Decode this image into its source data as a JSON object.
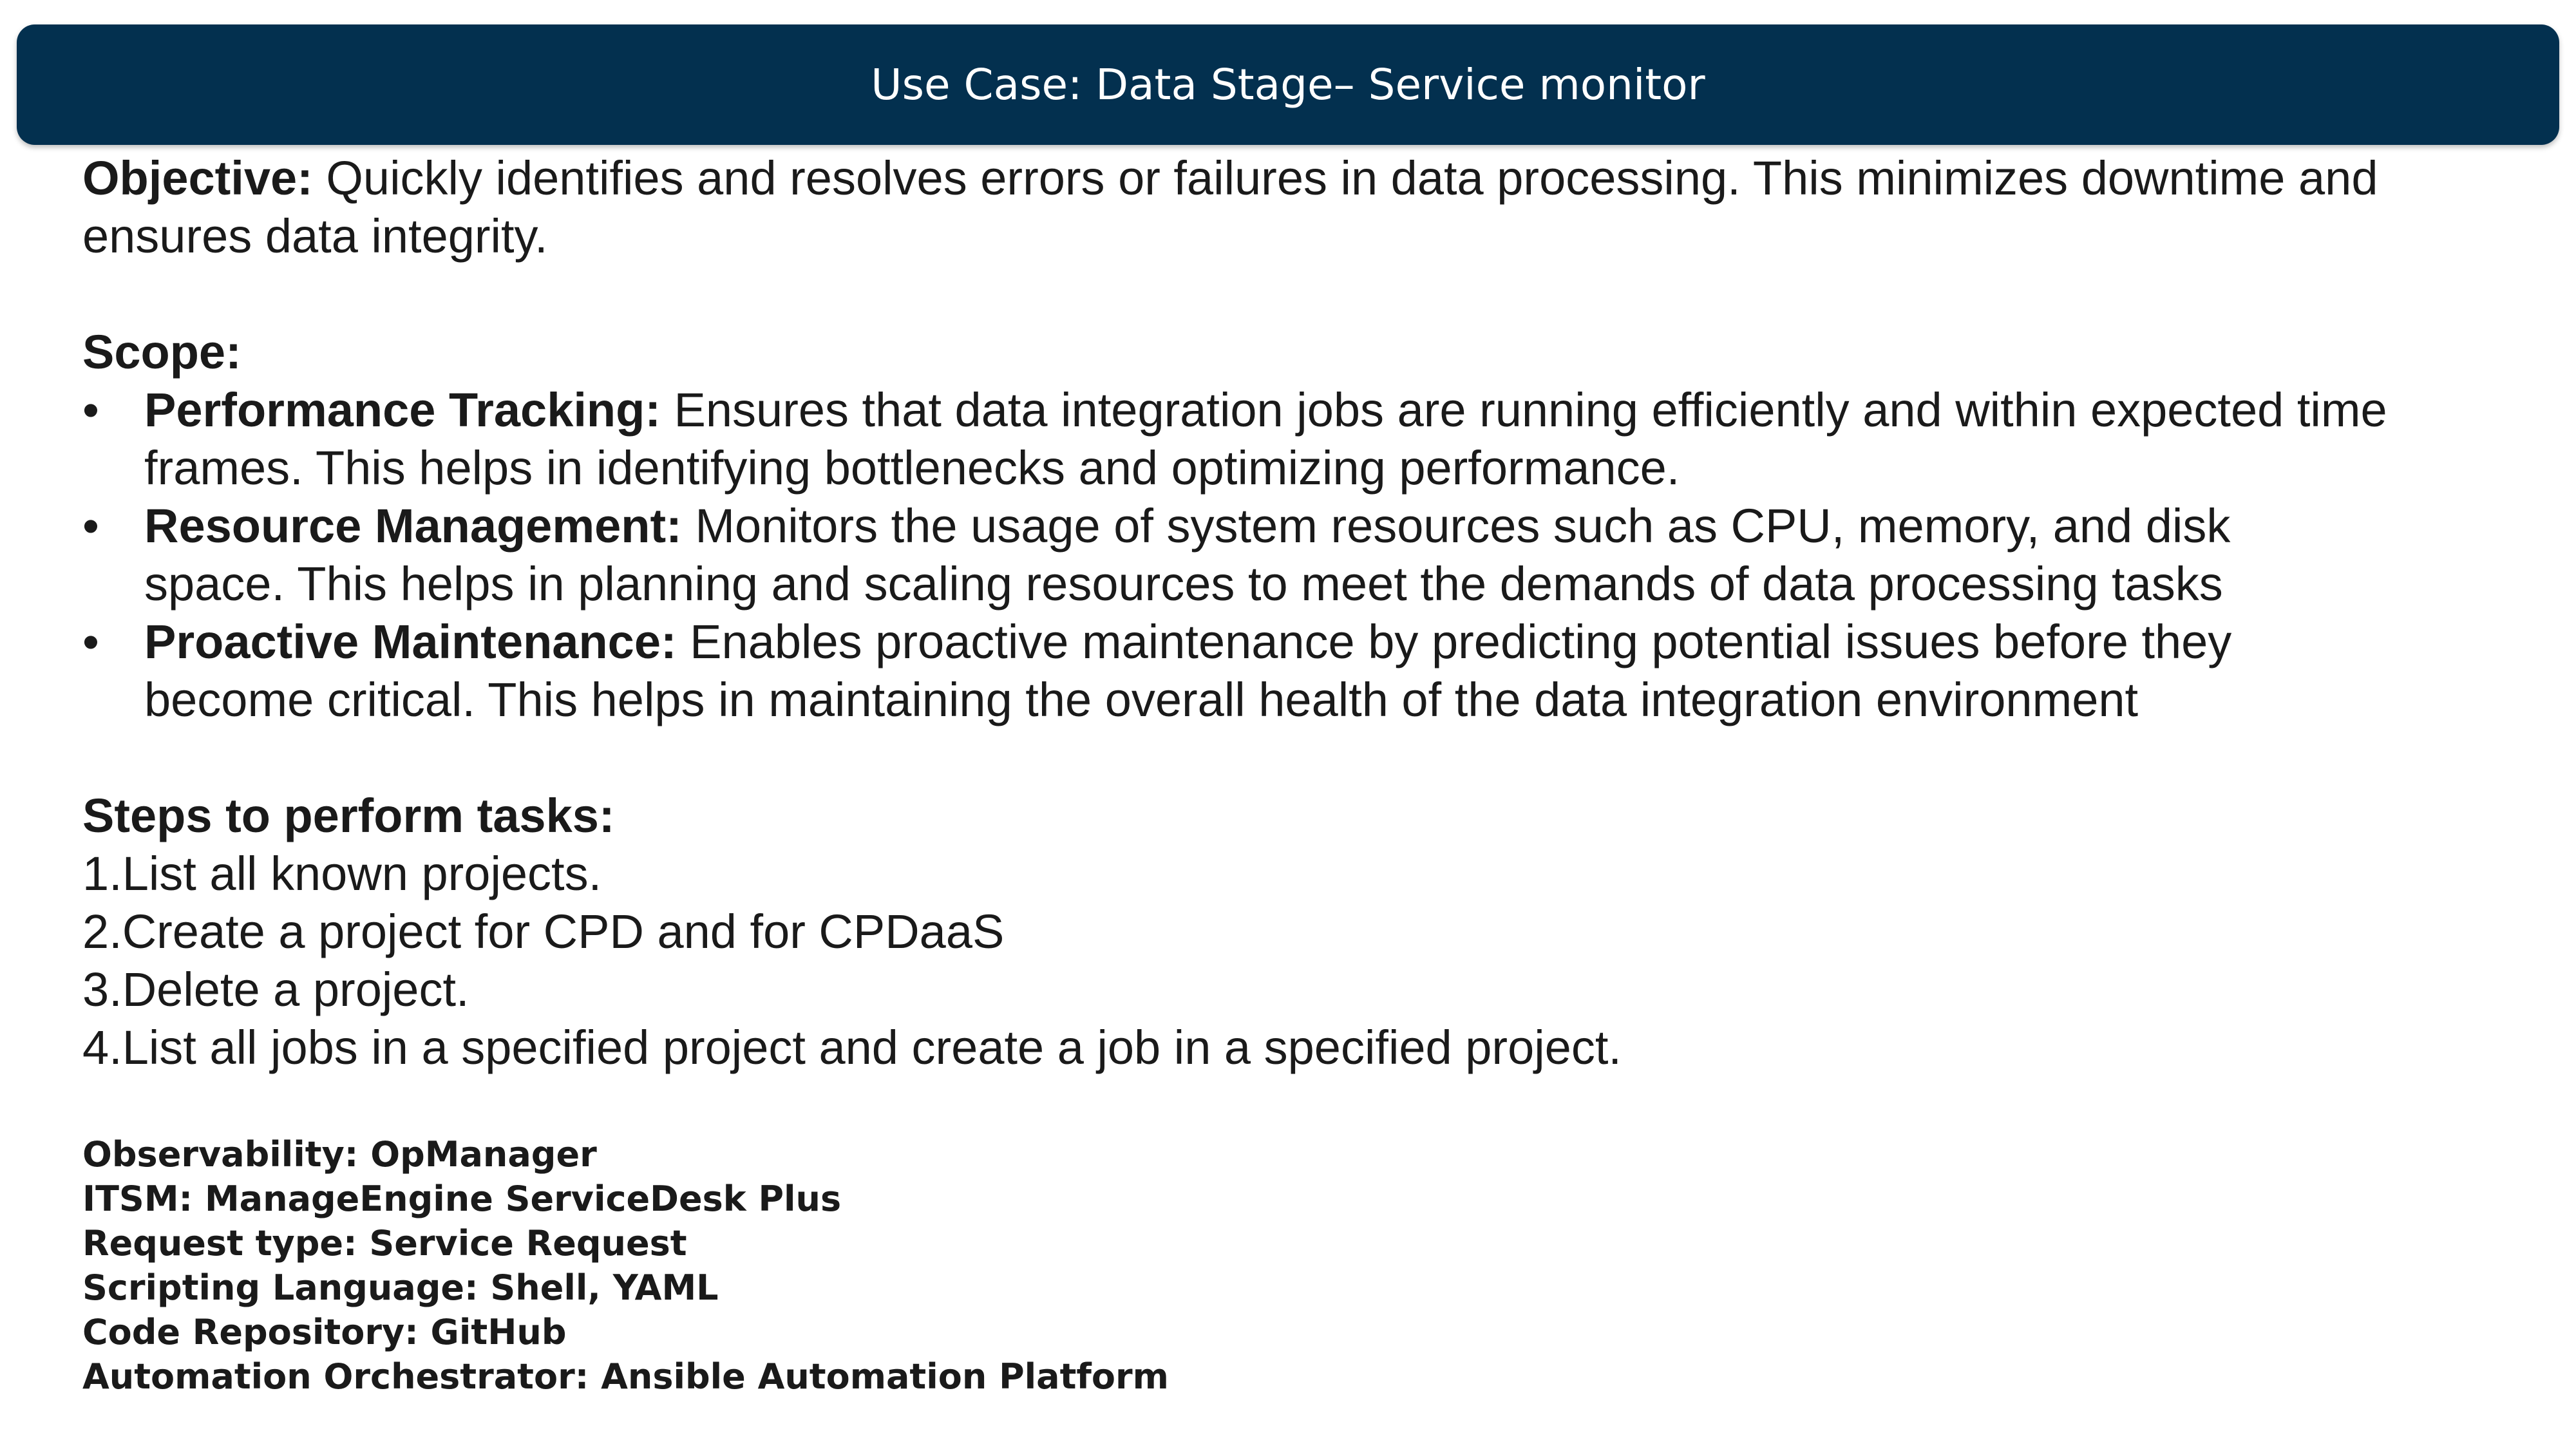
{
  "header": {
    "title": "Use Case: Data Stage– Service monitor"
  },
  "objective": {
    "label": "Objective:",
    "text": " Quickly identifies and resolves errors or failures in data processing. This minimizes downtime and ensures data integrity."
  },
  "scope": {
    "heading": "Scope:",
    "items": [
      {
        "title": "Performance Tracking:",
        "text": " Ensures that data integration jobs are running efficiently and within expected time frames. This helps in identifying bottlenecks and optimizing performance."
      },
      {
        "title": "Resource Management:",
        "text": " Monitors the usage of system resources such as CPU, memory, and disk space. This helps in planning and scaling resources to meet the demands of data processing tasks"
      },
      {
        "title": "Proactive Maintenance:",
        "text": " Enables proactive maintenance by predicting potential issues before they become critical. This helps in maintaining the overall health of the data integration environment"
      }
    ]
  },
  "steps": {
    "heading": "Steps to perform tasks:",
    "items": [
      "1.List all known projects.",
      "2.Create a project for CPD and for CPDaaS",
      "3.Delete a project.",
      "4.List all jobs in a specified project and create a job in a specified project."
    ]
  },
  "meta": {
    "lines": [
      "Observability: OpManager",
      "ITSM: ManageEngine ServiceDesk Plus",
      "Request type: Service Request",
      "Scripting Language: Shell, YAML",
      "Code Repository: GitHub",
      "Automation Orchestrator: Ansible Automation Platform"
    ]
  },
  "bullet_glyph": "•"
}
